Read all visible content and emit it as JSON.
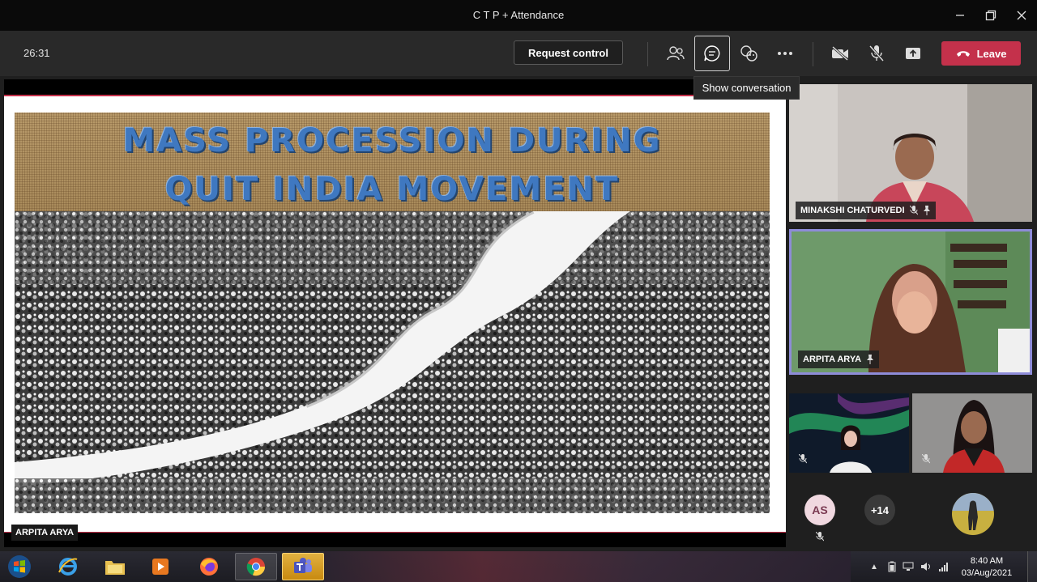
{
  "window": {
    "title": "C T P + Attendance"
  },
  "toolbar": {
    "timer": "26:31",
    "request_control_label": "Request control",
    "leave_label": "Leave",
    "tooltip": "Show conversation"
  },
  "stage": {
    "slide_title_line1": "MASS PROCESSION DURING",
    "slide_title_line2": "QUIT INDIA MOVEMENT",
    "presenter_name": "ARPITA ARYA"
  },
  "participants": {
    "tile1_name": "MINAKSHI CHATURVEDI",
    "tile2_name": "ARPITA ARYA",
    "avatar_initials": "AS",
    "more_count": "+14"
  },
  "taskbar": {
    "time": "8:40 AM",
    "date": "03/Aug/2021"
  },
  "colors": {
    "leave": "#c4314b",
    "accent_border": "#8e8cd8",
    "slide_title": "#3f78c0"
  }
}
